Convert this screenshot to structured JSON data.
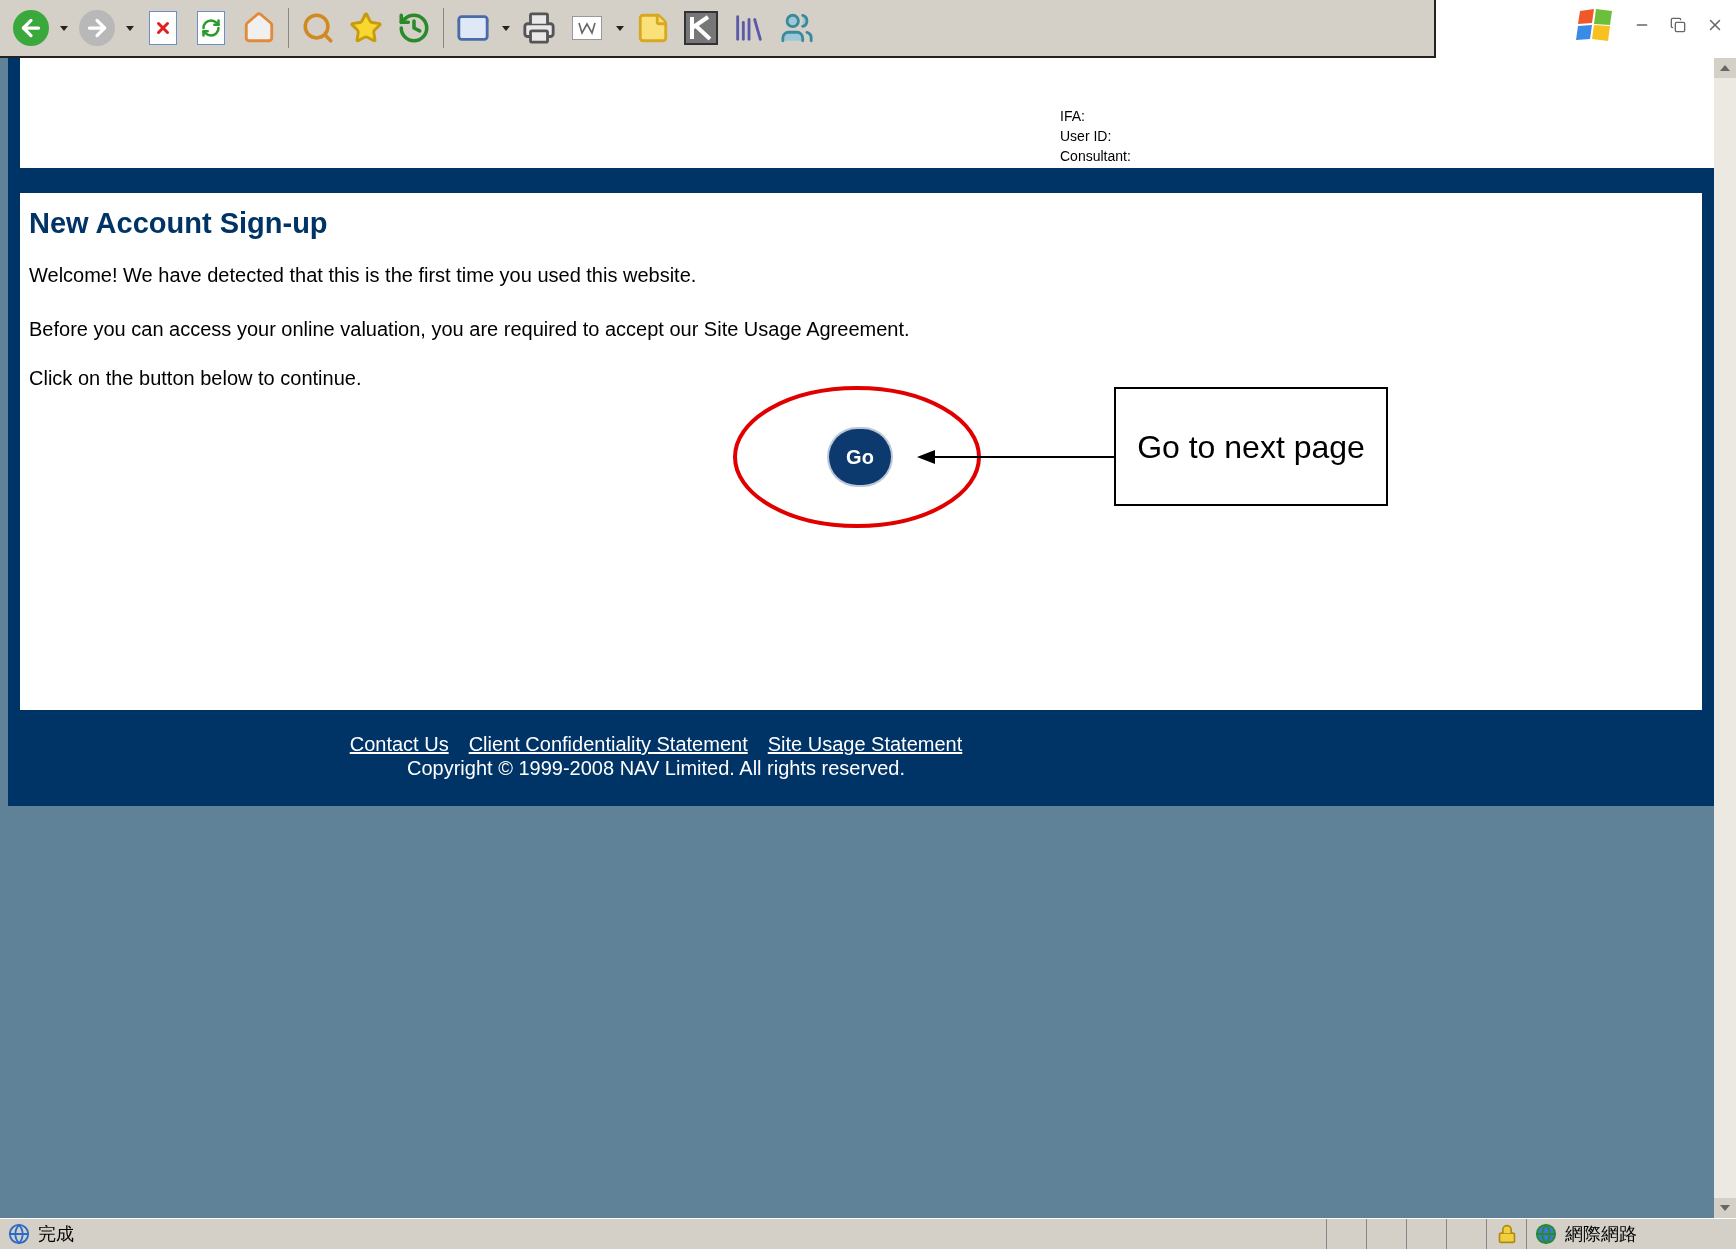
{
  "header": {
    "info_lines": [
      "IFA:",
      "User ID:",
      "Consultant:"
    ]
  },
  "content": {
    "title": "New Account Sign-up",
    "paragraphs": [
      "Welcome! We have detected that this is the first time you used this website.",
      "Before you can access your online valuation, you are required to accept our Site Usage Agreement.",
      "Click on the button below to continue."
    ],
    "button": "Go"
  },
  "annotation": {
    "callout": "Go to next page"
  },
  "footer": {
    "links": [
      "Contact Us",
      "Client Confidentiality Statement",
      "Site Usage Statement"
    ],
    "copyright": "Copyright © 1999-2008 NAV Limited. All rights reserved."
  },
  "status_bar": {
    "status": "完成",
    "zone": "網際網路"
  }
}
